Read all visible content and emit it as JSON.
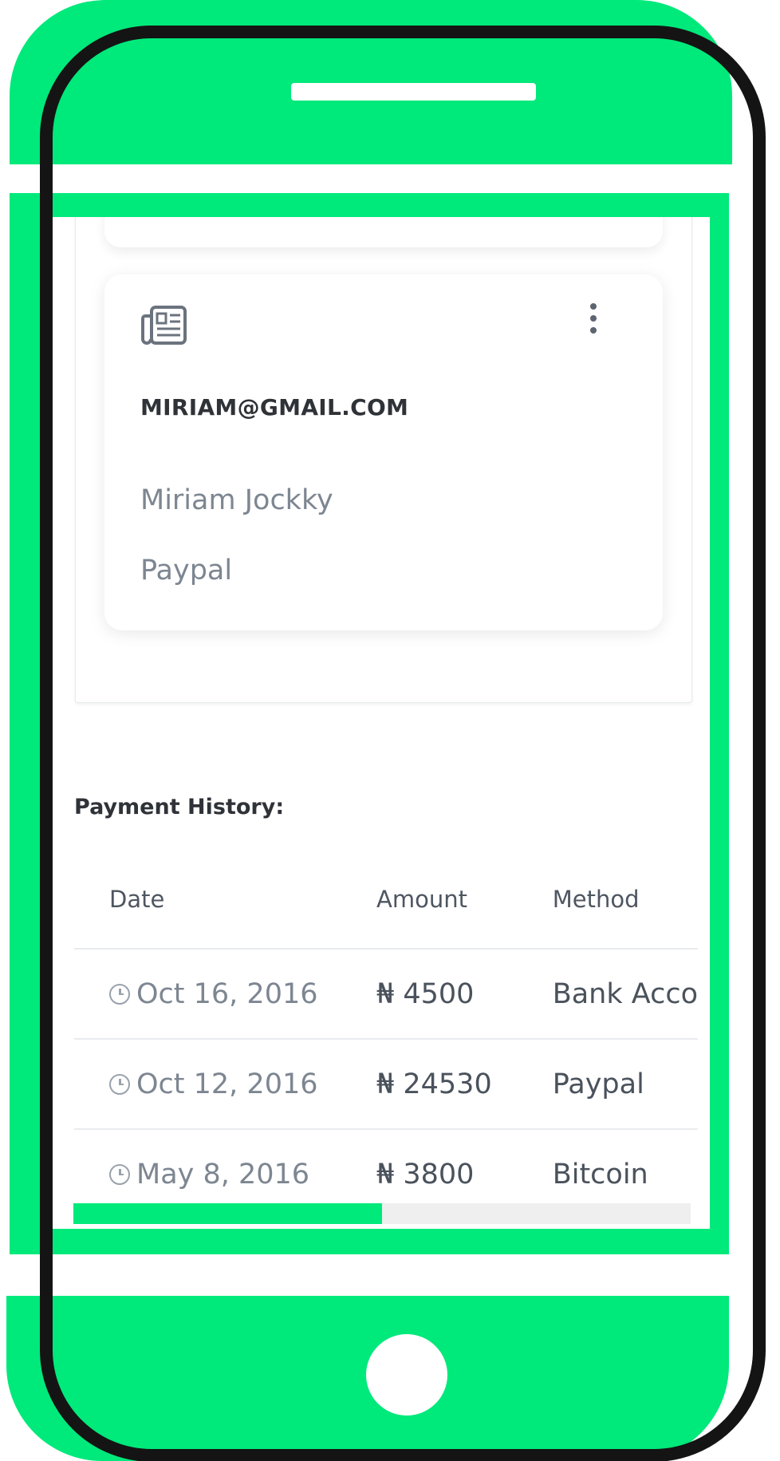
{
  "colors": {
    "brand_green": "#00e97b",
    "outline": "#141414",
    "muted_text": "#7d8691",
    "dark_text": "#2f3338"
  },
  "account_card": {
    "icon": "newspaper-icon",
    "menu_icon": "more-vertical-icon",
    "email": "MIRIAM@GMAIL.COM",
    "name": "Miriam Jockky",
    "method": "Paypal"
  },
  "payment_history": {
    "title": "Payment History:",
    "columns": [
      "Date",
      "Amount",
      "Method"
    ],
    "rows": [
      {
        "date": "Oct 16, 2016",
        "amount": "₦ 4500",
        "method": "Bank Acco"
      },
      {
        "date": "Oct 12, 2016",
        "amount": "₦ 24530",
        "method": "Paypal"
      },
      {
        "date": "May 8, 2016",
        "amount": "₦ 3800",
        "method": "Bitcoin"
      }
    ],
    "row_icon": "clock-icon"
  },
  "scroll": {
    "horizontal_position_fraction": 0.5
  }
}
